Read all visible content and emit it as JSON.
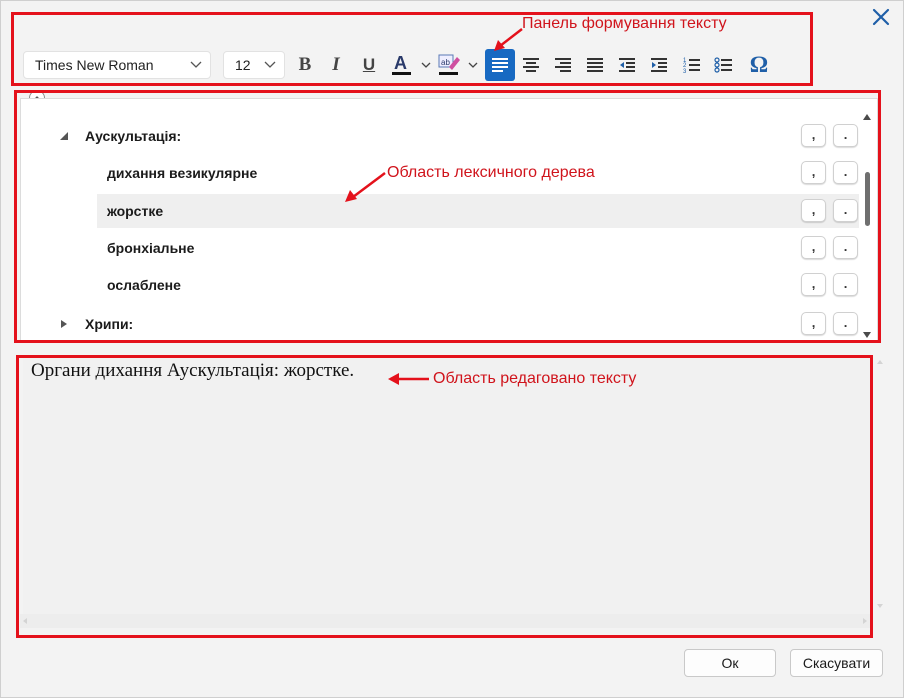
{
  "toolbar": {
    "font_family": "Times New Roman",
    "font_size": "12",
    "bold": "B",
    "italic": "I",
    "underline": "U",
    "special_char": "Ω"
  },
  "tree": {
    "group1": "Аускультація:",
    "items": [
      "дихання везикулярне",
      "жорстке",
      "бронхіальне",
      "ослаблене"
    ],
    "group2": "Хрипи:",
    "comma": ",",
    "period": "."
  },
  "editor": {
    "text": "Органи дихання Аускультація: жорстке."
  },
  "annotations": {
    "toolbar_label": "Панель формування тексту",
    "tree_label": "Область лексичного дерева",
    "editor_label": "Область редаговано тексту"
  },
  "buttons": {
    "ok": "Ок",
    "cancel": "Скасувати"
  },
  "colors": {
    "annotation": "#e4111b",
    "active_button": "#1769c2",
    "selected_row": "#efefef"
  }
}
